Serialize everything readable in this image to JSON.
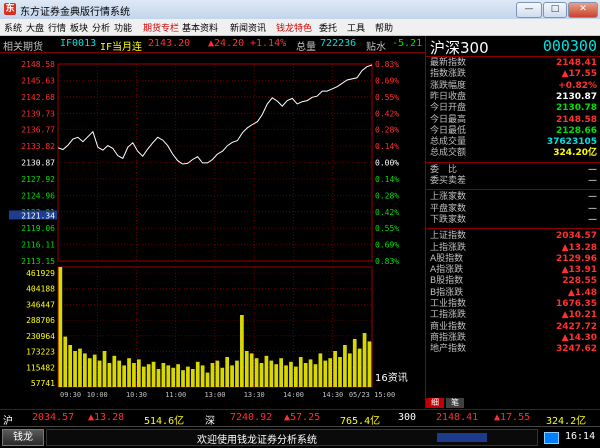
{
  "window": {
    "title": "东方证券金典版行情系统",
    "app_icon": "东"
  },
  "menu": [
    "系统",
    "大盘",
    "行情",
    "板块",
    "分析",
    "功能",
    "期货专栏",
    "基本资料",
    "新闻资讯",
    "钱龙特色",
    "委托",
    "工具",
    "帮助"
  ],
  "menu_highlight": [
    6,
    9
  ],
  "header": {
    "name": "相关期货",
    "code": "IF0013",
    "contract": "IF当月连",
    "price": "2143.20",
    "change": "▲24.20",
    "change_pct": "+1.14%",
    "volume_label": "总量",
    "volume": "722236",
    "premium_label": "贴水",
    "premium": "-5.21"
  },
  "index_panel": {
    "name": "沪深300",
    "code": "000300",
    "rows": [
      {
        "label": "最新指数",
        "value": "2148.41",
        "color": "#ff3030"
      },
      {
        "label": "指数涨跌",
        "value": "▲17.55",
        "color": "#ff3030"
      },
      {
        "label": "涨跌幅度",
        "value": "+0.82%",
        "color": "#ff3030"
      },
      {
        "label": "昨日收盘",
        "value": "2130.87",
        "color": "#ffffff"
      },
      {
        "label": "今日开盘",
        "value": "2130.78",
        "color": "#00e000"
      },
      {
        "label": "今日最高",
        "value": "2148.58",
        "color": "#ff3030"
      },
      {
        "label": "今日最低",
        "value": "2128.66",
        "color": "#00e000"
      },
      {
        "label": "总成交量",
        "value": "37623105",
        "color": "#00e0e0"
      },
      {
        "label": "总成交额",
        "value": "324.20亿",
        "color": "#ffff00"
      }
    ],
    "ratio_rows": [
      {
        "label": "委　比",
        "value": "—"
      },
      {
        "label": "委买卖差",
        "value": "—"
      }
    ],
    "breadth_rows": [
      {
        "label": "上涨家数",
        "value": "—"
      },
      {
        "label": "平盘家数",
        "value": "—"
      },
      {
        "label": "下跌家数",
        "value": "—"
      }
    ],
    "market_rows": [
      {
        "label": "上证指数",
        "value": "2034.57",
        "color": "#ff3030"
      },
      {
        "label": "上指涨跌",
        "value": "▲13.28",
        "color": "#ff3030"
      },
      {
        "label": "A股指数",
        "value": "2129.96",
        "color": "#ff3030"
      },
      {
        "label": "A指涨跌",
        "value": "▲13.91",
        "color": "#ff3030"
      },
      {
        "label": "B股指数",
        "value": "228.55",
        "color": "#ff3030"
      },
      {
        "label": "B指涨跌",
        "value": "▲1.48",
        "color": "#ff3030"
      },
      {
        "label": "工业指数",
        "value": "1676.35",
        "color": "#ff3030"
      },
      {
        "label": "工指涨跌",
        "value": "▲10.21",
        "color": "#ff3030"
      },
      {
        "label": "商业指数",
        "value": "2427.72",
        "color": "#ff3030"
      },
      {
        "label": "商指涨跌",
        "value": "▲14.30",
        "color": "#ff3030"
      },
      {
        "label": "地产指数",
        "value": "3247.62",
        "color": "#ff3030"
      }
    ],
    "tabs": [
      "细",
      "笔"
    ]
  },
  "chart_data": {
    "type": "line",
    "price_ticks": [
      "2148.58",
      "2145.63",
      "2142.68",
      "2139.73",
      "2136.77",
      "2133.82",
      "2130.87",
      "2127.92",
      "2124.96",
      "2122.01",
      "2119.06",
      "2116.11",
      "2113.15"
    ],
    "price_highlight": "2121.34",
    "pct_ticks": [
      "0.83%",
      "0.69%",
      "0.55%",
      "0.42%",
      "0.28%",
      "0.14%",
      "0.00%",
      "0.14%",
      "0.28%",
      "0.42%",
      "0.55%",
      "0.69%",
      "0.83%"
    ],
    "volume_ticks": [
      "461929",
      "404188",
      "346447",
      "288706",
      "230964",
      "173223",
      "115482",
      "57741"
    ],
    "time_ticks": [
      "09:30",
      "10:00",
      "10:30",
      "11:00",
      "13:00",
      "13:30",
      "14:00",
      "14:30",
      "15:00"
    ],
    "last_time": "05/23 15:00",
    "ylim": [
      2113.15,
      2148.58
    ],
    "prev_close": 2130.87,
    "price_series": [
      2133.5,
      2133.2,
      2134.0,
      2135.1,
      2135.4,
      2134.6,
      2135.5,
      2136.4,
      2133.6,
      2133.1,
      2133.9,
      2133.4,
      2132.1,
      2131.6,
      2133.6,
      2134.4,
      2132.9,
      2132.0,
      2133.3,
      2134.4,
      2135.4,
      2134.9,
      2133.9,
      2132.4,
      2131.2,
      2130.6,
      2130.7,
      2131.4,
      2131.9,
      2130.8,
      2130.8,
      2131.4,
      2132.4,
      2132.9,
      2133.9,
      2134.5,
      2134.8,
      2136.2,
      2137.1,
      2137.7,
      2138.2,
      2139.5,
      2141.4,
      2142.5,
      2141.9,
      2141.0,
      2142.0,
      2142.4,
      2141.4,
      2141.8,
      2142.0,
      2142.6,
      2142.8,
      2143.7,
      2143.7,
      2144.1,
      2144.5,
      2145.1,
      2145.7,
      2145.9,
      2146.1,
      2147.4,
      2148.1,
      2148.4
    ],
    "volume_series": [
      1.0,
      0.42,
      0.35,
      0.3,
      0.32,
      0.28,
      0.24,
      0.27,
      0.22,
      0.3,
      0.2,
      0.26,
      0.22,
      0.18,
      0.24,
      0.2,
      0.23,
      0.17,
      0.19,
      0.21,
      0.15,
      0.2,
      0.18,
      0.16,
      0.19,
      0.14,
      0.17,
      0.15,
      0.21,
      0.18,
      0.12,
      0.2,
      0.22,
      0.16,
      0.25,
      0.18,
      0.22,
      0.6,
      0.3,
      0.28,
      0.24,
      0.2,
      0.26,
      0.22,
      0.19,
      0.24,
      0.18,
      0.21,
      0.17,
      0.25,
      0.2,
      0.23,
      0.19,
      0.28,
      0.22,
      0.24,
      0.3,
      0.25,
      0.35,
      0.28,
      0.4,
      0.32,
      0.45,
      0.38
    ],
    "news_label": "16资讯"
  },
  "status": {
    "sh_label": "沪",
    "sh_index": "2034.57",
    "sh_change": "▲13.28",
    "sh_amount": "514.6亿",
    "sz_label": "深",
    "sz_index": "7240.92",
    "sz_change": "▲57.25",
    "sz_amount": "765.4亿",
    "hs300_label": "300",
    "hs300_index": "2148.41",
    "hs300_change": "▲17.55",
    "hs300_amount": "324.2亿"
  },
  "bottom": {
    "brand": "钱龙",
    "message": "欢迎使用钱龙证券分析系统",
    "time": "16:14"
  }
}
